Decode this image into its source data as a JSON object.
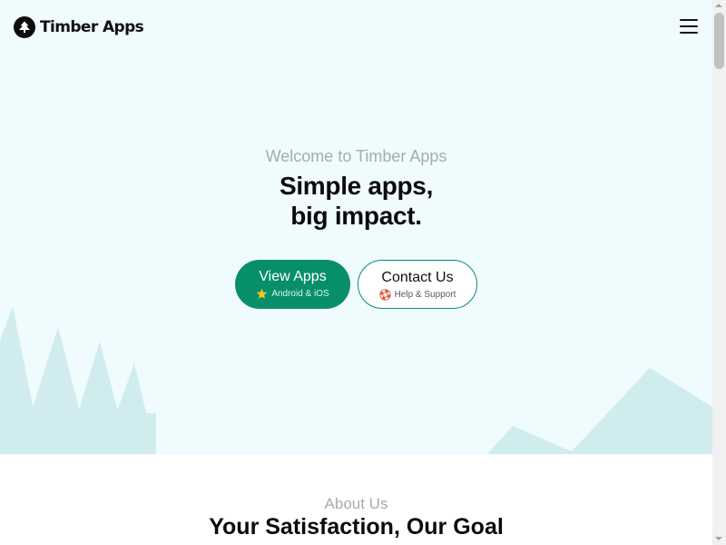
{
  "header": {
    "brand": "Timber Apps",
    "logo_icon": "tree-icon",
    "menu_icon": "hamburger-menu-icon"
  },
  "hero": {
    "eyebrow": "Welcome to Timber Apps",
    "title_line1": "Simple apps,",
    "title_line2": "big impact.",
    "background_color": "#effbfd",
    "decoration_color": "#d1ecee",
    "primary_button": {
      "label": "View Apps",
      "sub_label": "Android & iOS",
      "icon": "star-icon",
      "color": "#078f6c"
    },
    "secondary_button": {
      "label": "Contact Us",
      "sub_label": "Help & Support",
      "icon": "lifebuoy-icon",
      "border_color": "#078f6c"
    }
  },
  "about": {
    "eyebrow": "About Us",
    "title": "Your Satisfaction, Our Goal"
  }
}
